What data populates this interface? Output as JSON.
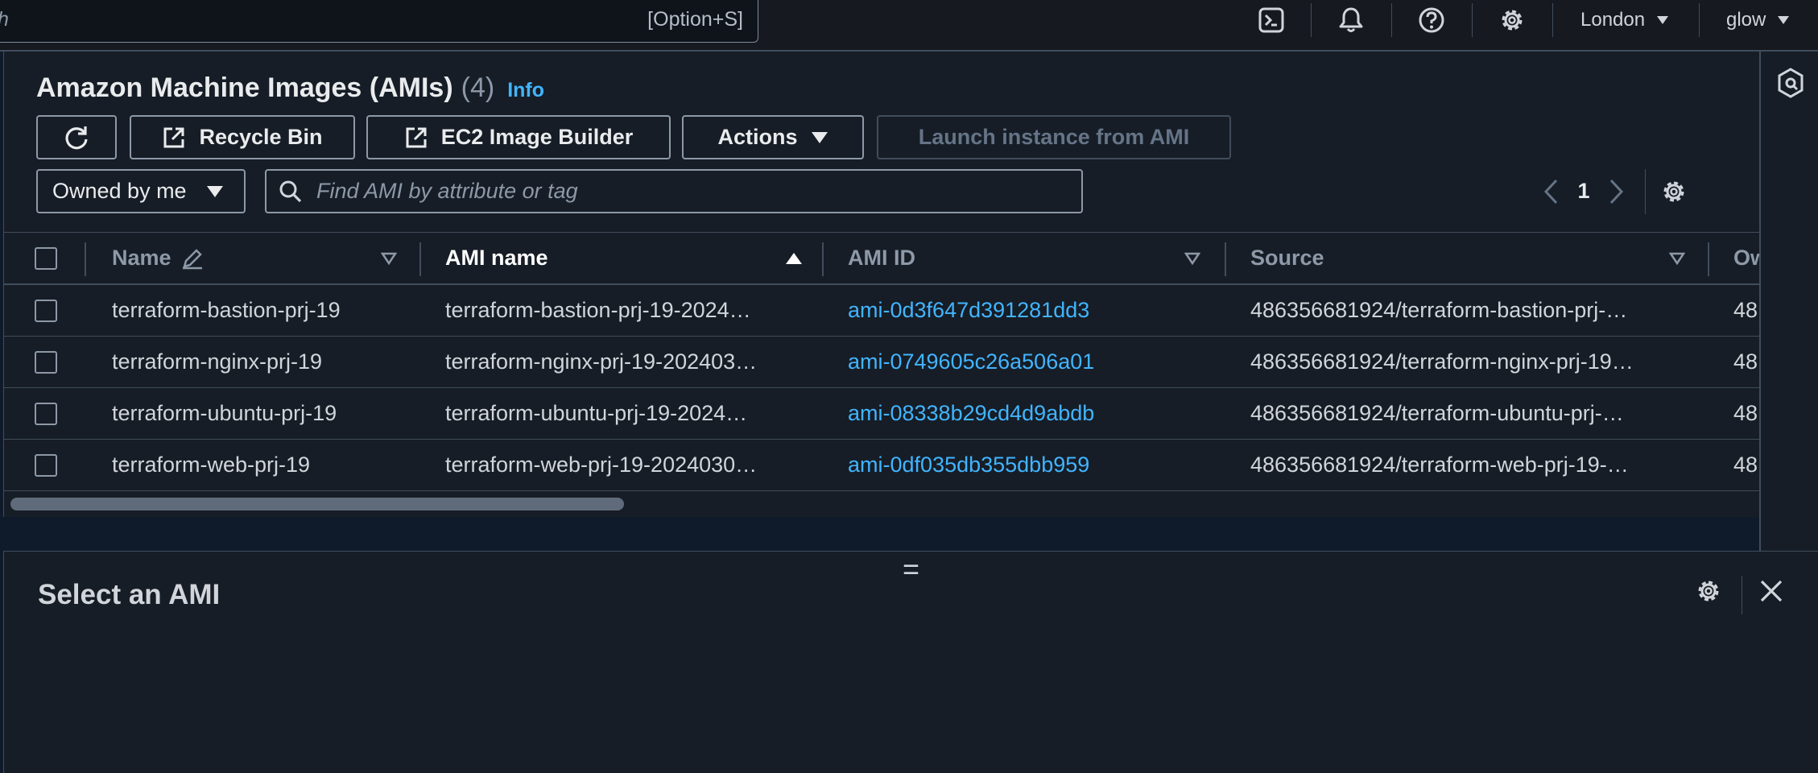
{
  "topnav": {
    "search_placeholder": "h",
    "search_shortcut": "[Option+S]",
    "region": "London",
    "account": "glow"
  },
  "page": {
    "title": "Amazon Machine Images (AMIs)",
    "count": "(4)",
    "info": "Info"
  },
  "toolbar": {
    "recycle_bin": "Recycle Bin",
    "image_builder": "EC2 Image Builder",
    "actions": "Actions",
    "launch": "Launch instance from AMI"
  },
  "filter": {
    "owner": "Owned by me",
    "search_placeholder": "Find AMI by attribute or tag"
  },
  "pagination": {
    "current_page": "1"
  },
  "table": {
    "columns": {
      "name": "Name",
      "ami_name": "AMI name",
      "ami_id": "AMI ID",
      "source": "Source",
      "owner": "Ow"
    },
    "rows": [
      {
        "name": "terraform-bastion-prj-19",
        "ami_name": "terraform-bastion-prj-19-2024…",
        "ami_id": "ami-0d3f647d391281dd3",
        "source": "486356681924/terraform-bastion-prj-…",
        "owner": "48"
      },
      {
        "name": "terraform-nginx-prj-19",
        "ami_name": "terraform-nginx-prj-19-202403…",
        "ami_id": "ami-0749605c26a506a01",
        "source": "486356681924/terraform-nginx-prj-19…",
        "owner": "48"
      },
      {
        "name": "terraform-ubuntu-prj-19",
        "ami_name": "terraform-ubuntu-prj-19-2024…",
        "ami_id": "ami-08338b29cd4d9abdb",
        "source": "486356681924/terraform-ubuntu-prj-…",
        "owner": "48"
      },
      {
        "name": "terraform-web-prj-19",
        "ami_name": "terraform-web-prj-19-2024030…",
        "ami_id": "ami-0df035db355dbb959",
        "source": "486356681924/terraform-web-prj-19-…",
        "owner": "48"
      }
    ]
  },
  "split_panel": {
    "handle": "=",
    "title": "Select an AMI"
  },
  "colors": {
    "link": "#42b4ff",
    "background": "#161d26",
    "border": "#414d5c"
  }
}
